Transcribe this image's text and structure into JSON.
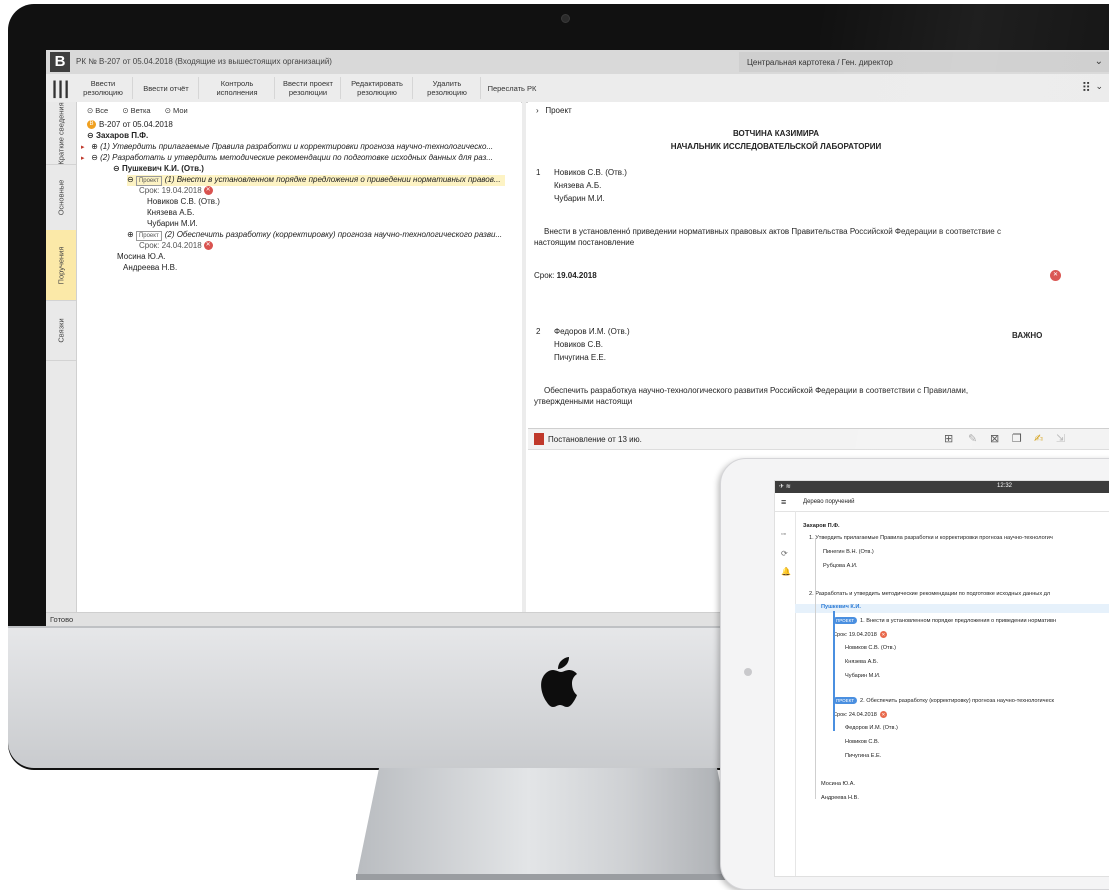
{
  "app": {
    "logo_letter": "B",
    "window_title": "РК № В-207 от 05.04.2018 (Входящие из вышестоящих организаций)",
    "org_selector": "Центральная картотека / Ген. директор",
    "status_text": "Готово"
  },
  "toolbar": {
    "buttons": [
      {
        "label": "Ввести резолюцию"
      },
      {
        "label": "Ввести отчёт"
      },
      {
        "label": "Контроль исполнения"
      },
      {
        "label": "Ввести проект резолюции"
      },
      {
        "label": "Редактировать резолюцию"
      },
      {
        "label": "Удалить резолюцию"
      },
      {
        "label": "Переслать РК"
      }
    ]
  },
  "side_tabs": [
    {
      "label": "Краткие сведения"
    },
    {
      "label": "Основные"
    },
    {
      "label": "Поручения"
    },
    {
      "label": "Связки"
    }
  ],
  "tree": {
    "filters": [
      "Все",
      "Ветка",
      "Мои"
    ],
    "root": "В-207 от 05.04.2018",
    "author": "Захаров П.Ф.",
    "item1": "(1) Утвердить прилагаемые Правила разработки и корректировки прогноза научно-технологическо...",
    "item2": "(2) Разработать и утвердить методические рекомендации по подготовке исходных данных для раз...",
    "executor": "Пушкевич К.И. (Отв.)",
    "proj_badge": "Проект",
    "proj1": "(1) Внести в установленном порядке предложения о приведении нормативных правов...",
    "proj1_deadline": "Срок: 19.04.2018",
    "proj1_people": [
      "Новиков С.В. (Отв.)",
      "Князева А.Б.",
      "Чубарин М.И."
    ],
    "proj2": "(2) Обеспечить разработку (корректировку) прогноза научно-технологического разви...",
    "proj2_deadline": "Срок: 24.04.2018",
    "others": [
      "Мосина Ю.А.",
      "Андреева Н.В."
    ]
  },
  "document": {
    "breadcrumb": "Проект",
    "header_name": "ВОТЧИНА КАЗИМИРА",
    "header_title": "НАЧАЛЬНИК ИССЛЕДОВАТЕЛЬСКОЙ ЛАБОРАТОРИИ",
    "p1_num": "1",
    "p1_people": [
      "Новиков С.В. (Отв.)",
      "Князева А.Б.",
      "Чубарин М.И."
    ],
    "p1_text_line1": "Внести в установленно́ приведении нормативных правовых актов Правительства Российской Федерации в соответствие с",
    "p1_text_line2": "настоящим постановление",
    "deadline_label": "Срок:",
    "deadline_value": "19.04.2018",
    "important": "ВАЖНО",
    "p2_num": "2",
    "p2_people": [
      "Федоров И.М. (Отв.)",
      "Новиков С.В.",
      "Пичугина Е.Е."
    ],
    "p2_text_line1": "Обеспечить разработкуа научно-технологического развития Российской Федерации в соответствии с Правилами,",
    "p2_text_line2": "утвержденными настоящи"
  },
  "attachment": {
    "title": "Постановление от 13 ию."
  },
  "ipad": {
    "time": "12:32",
    "header": "Дерево поручений",
    "author": "Захаров П.Ф.",
    "item1": "1. Утвердить прилагаемые Правила разработки и корректировки прогноза научно-технологич",
    "item1_people": [
      "Пинегин В.Н. (Отв.)",
      "Рубцова А.И."
    ],
    "item2": "2. Разработать и утвердить методические рекомендации по подготовке исходных данных дл",
    "executor": "Пушкевич К.И.",
    "badge": "ПРОЕКТ",
    "proj1": "1. Внести в установленном порядке предложения о приведении нормативн",
    "proj1_deadline": "Срок: 19.04.2018",
    "proj1_people": [
      "Новиков С.В. (Отв.)",
      "Князева А.Б.",
      "Чубарин М.И."
    ],
    "proj2": "2. Обеспечить разработку (корректировку) прогноза научно-технологическ",
    "proj2_deadline": "Срок: 24.04.2018",
    "proj2_people": [
      "Федоров И.М. (Отв.)",
      "Новиков С.В.",
      "Пичугина Е.Е."
    ],
    "others": [
      "Мосина Ю.А.",
      "Андреева Н.В."
    ]
  }
}
